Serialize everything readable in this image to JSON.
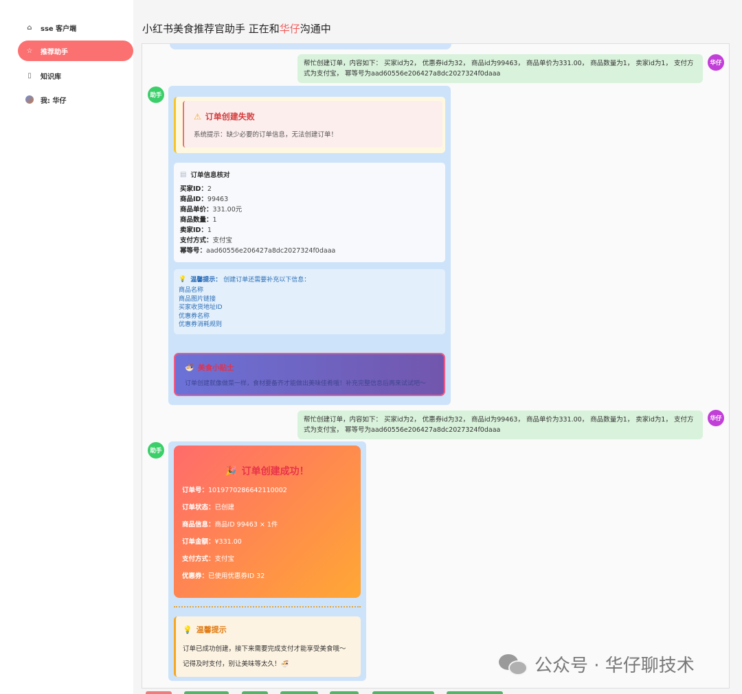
{
  "sidebar": {
    "items": [
      {
        "label": "sse 客户端",
        "icon": "home-icon"
      },
      {
        "label": "推荐助手",
        "icon": "star-icon"
      },
      {
        "label": "知识库",
        "icon": "book-icon"
      },
      {
        "label": "我: 华仔",
        "icon": "avatar"
      }
    ]
  },
  "header": {
    "title_prefix": "小红书美食推荐官助手 正在和",
    "title_name": "华仔",
    "title_suffix": "沟通中"
  },
  "messages": {
    "user_1": "帮忙创建订单，内容如下： 买家id为2， 优惠券id为32， 商品id为99463， 商品单价为331.00， 商品数量为1， 卖家id为1， 支付方式为支付宝， 幂等号为aad60556e206427a8dc2027324f0daaa",
    "user_2": "帮忙创建订单，内容如下： 买家id为2， 优惠券id为32， 商品id为99463， 商品单价为331.00， 商品数量为1， 卖家id为1， 支付方式为支付宝， 幂等号为aad60556e206427a8dc2027324f0daaa",
    "user_avatar": "华仔",
    "bot_avatar": "助手"
  },
  "fail_reply": {
    "error_title": "订单创建失败",
    "error_text": "系统提示：缺少必要的订单信息，无法创建订单！",
    "info_title": "订单信息核对",
    "info_rows": [
      {
        "k": "买家ID：",
        "v": "2"
      },
      {
        "k": "商品ID：",
        "v": "99463"
      },
      {
        "k": "商品单价：",
        "v": "331.00元"
      },
      {
        "k": "商品数量：",
        "v": "1"
      },
      {
        "k": "卖家ID：",
        "v": "1"
      },
      {
        "k": "支付方式：",
        "v": "支付宝"
      },
      {
        "k": "幂等号：",
        "v": "aad60556e206427a8dc2027324f0daaa"
      }
    ],
    "tip_label": "温馨提示：",
    "tip_text": "创建订单还需要补充以下信息：",
    "tip_items": [
      "商品名称",
      "商品图片链接",
      "买家收货地址ID",
      "优惠券名称",
      "优惠券消耗规则"
    ],
    "bad_title": "美食小贴士",
    "bad_text": "订单创建就像做菜一样，食材要备齐才能做出美味佳肴哦！补充完整信息后再来试试吧～"
  },
  "success_reply": {
    "title": "订单创建成功！",
    "rows": [
      {
        "k": "订单号：",
        "v": "1019770286642110002"
      },
      {
        "k": "订单状态：",
        "v": "已创建"
      },
      {
        "k": "商品信息：",
        "v": "商品ID 99463 × 1件"
      },
      {
        "k": "订单金额：",
        "v": "¥331.00"
      },
      {
        "k": "支付方式：",
        "v": "支付宝"
      },
      {
        "k": "优惠券：",
        "v": "已使用优惠券ID 32"
      }
    ],
    "warm_title": "温馨提示",
    "warm_line1": "订单已成功创建，接下来需要完成支付才能享受美食哦～",
    "warm_line2": "记得及时支付，别让美味等太久！🍜"
  },
  "watermark": "公众号 · 华仔聊技术",
  "colors": {
    "accent": "#fb7070",
    "user_bubble": "#d9f2db",
    "bot_bubble": "#cde3fa",
    "user_avatar": "#c23ed8",
    "bot_avatar": "#3bcf6a"
  }
}
